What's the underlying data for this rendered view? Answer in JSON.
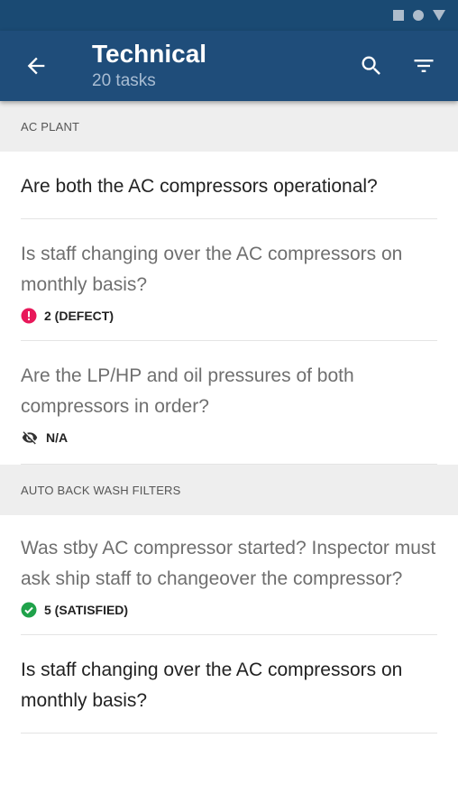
{
  "header": {
    "title": "Technical",
    "subtitle": "20 tasks",
    "back_icon": "arrow-back-icon",
    "search_icon": "search-icon",
    "filter_icon": "filter-icon"
  },
  "colors": {
    "app_bar": "#1f4d7a",
    "status_bar": "#1a4a73",
    "defect": "#e8185a",
    "satisfied": "#1fa24a"
  },
  "sections": [
    {
      "title": "AC PLANT",
      "items": [
        {
          "text": "Are both the AC compressors operational?"
        },
        {
          "text": "Is staff changing over the AC compressors on monthly basis?",
          "status": "2 (DEFECT)",
          "status_icon": "defect-alert-icon"
        },
        {
          "text": "Are the LP/HP and oil pressures of both compressors in order?",
          "status": "N/A",
          "status_icon": "visibility-off-icon"
        }
      ]
    },
    {
      "title": "AUTO BACK WASH FILTERS",
      "items": [
        {
          "text": "Was stby AC compressor started? Inspector must ask ship staff to changeover the compressor?",
          "status": "5 (SATISFIED)",
          "status_icon": "check-circle-icon"
        },
        {
          "text": "Is staff changing over the AC compressors on monthly basis?"
        }
      ]
    }
  ]
}
